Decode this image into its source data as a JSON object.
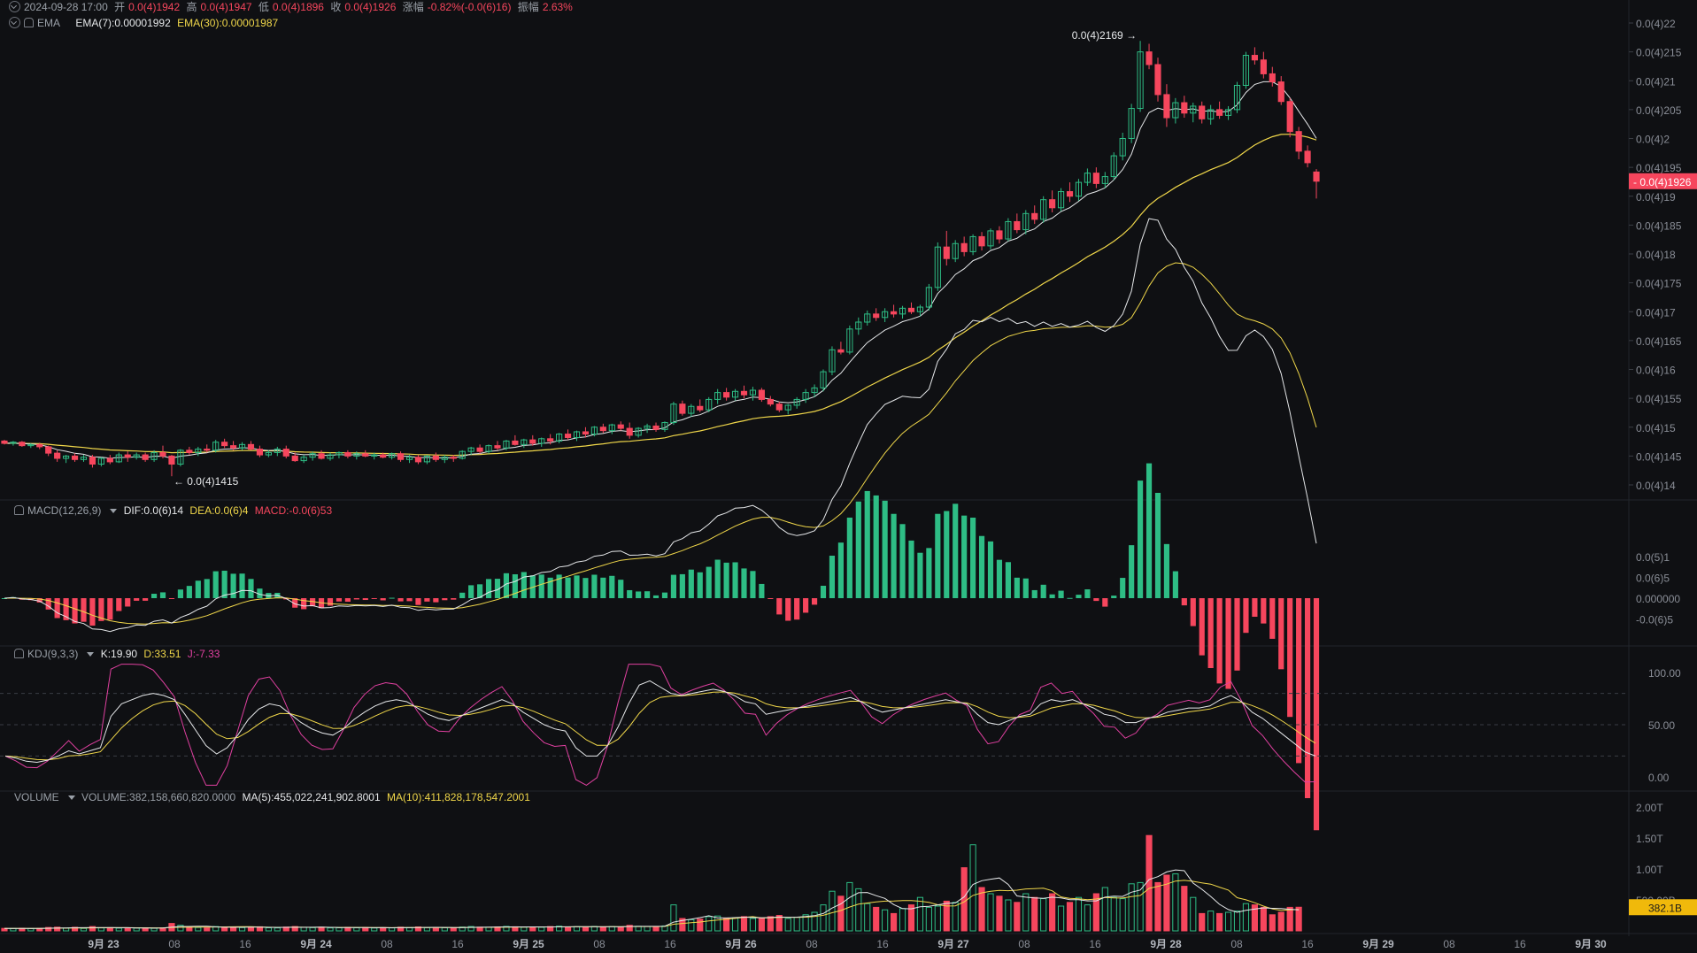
{
  "header": {
    "datetime": "2024-09-28 17:00",
    "open_label": "开",
    "open": "0.0(4)1942",
    "high_label": "高",
    "high": "0.0(4)1947",
    "low_label": "低",
    "low": "0.0(4)1896",
    "close_label": "收",
    "close": "0.0(4)1926",
    "change_label": "涨幅",
    "change": "-0.82%(-0.0(6)16)",
    "amplitude_label": "振幅",
    "amplitude": "2.63%"
  },
  "ema_legend": {
    "name": "EMA",
    "ema7": "EMA(7):0.00001992",
    "ema30": "EMA(30):0.00001987"
  },
  "macd_legend": {
    "name": "MACD(12,26,9)",
    "dif": "DIF:0.0(6)14",
    "dea": "DEA:0.0(6)4",
    "macd": "MACD:-0.0(6)53"
  },
  "kdj_legend": {
    "name": "KDJ(9,3,3)",
    "k": "K:19.90",
    "d": "D:33.51",
    "j": "J:-7.33"
  },
  "volume_legend": {
    "name": "VOLUME",
    "volume": "VOLUME:382,158,660,820.0000",
    "ma5": "MA(5):455,022,241,902.8001",
    "ma10": "MA(10):411,828,178,547.2001"
  },
  "colors": {
    "up": "#2ebd85",
    "down": "#f6465d",
    "ema7": "#e6e8ea",
    "ema30": "#f0d74a",
    "kdj_j": "#e040a0",
    "background": "#0f1013",
    "price_tag": "#f6465d",
    "volume_tag": "#f0b90b"
  },
  "chart_data": {
    "type": "candlestick",
    "price_axis_labels": [
      "0.0(4)22",
      "0.0(4)215",
      "0.0(4)21",
      "0.0(4)205",
      "0.0(4)2",
      "0.0(4)195",
      "0.0(4)19",
      "0.0(4)185",
      "0.0(4)18",
      "0.0(4)175",
      "0.0(4)17",
      "0.0(4)165",
      "0.0(4)16",
      "0.0(4)155",
      "0.0(4)15",
      "0.0(4)145",
      "0.0(4)14"
    ],
    "price_axis_values": [
      2.2e-05,
      2.15e-05,
      2.1e-05,
      2.05e-05,
      2e-05,
      1.95e-05,
      1.9e-05,
      1.85e-05,
      1.8e-05,
      1.75e-05,
      1.7e-05,
      1.65e-05,
      1.6e-05,
      1.55e-05,
      1.5e-05,
      1.45e-05,
      1.4e-05
    ],
    "current_price_label": "0.0(4)1926",
    "current_price": 1.926e-05,
    "max_marker": {
      "label": "0.0(4)2169 →",
      "value": 2.169e-05
    },
    "min_marker": {
      "label": "← 0.0(4)1415",
      "value": 1.415e-05
    },
    "time_axis_labels": [
      "9月 23",
      "08",
      "16",
      "9月 24",
      "08",
      "16",
      "9月 25",
      "08",
      "16",
      "9月 26",
      "08",
      "16",
      "9月 27",
      "08",
      "16",
      "9月 28",
      "08",
      "16",
      "9月 29",
      "08",
      "16",
      "9月 30"
    ],
    "hours_per_candle": 1,
    "candles": [
      [
        1.476,
        1.478,
        1.47,
        1.472
      ],
      [
        1.472,
        1.476,
        1.468,
        1.474
      ],
      [
        1.474,
        1.476,
        1.466,
        1.468
      ],
      [
        1.468,
        1.472,
        1.464,
        1.47
      ],
      [
        1.47,
        1.473,
        1.462,
        1.466
      ],
      [
        1.466,
        1.468,
        1.45,
        1.455
      ],
      [
        1.455,
        1.46,
        1.44,
        1.446
      ],
      [
        1.446,
        1.452,
        1.438,
        1.45
      ],
      [
        1.45,
        1.455,
        1.44,
        1.444
      ],
      [
        1.444,
        1.452,
        1.44,
        1.448
      ],
      [
        1.448,
        1.452,
        1.43,
        1.436
      ],
      [
        1.436,
        1.448,
        1.432,
        1.446
      ],
      [
        1.446,
        1.452,
        1.436,
        1.44
      ],
      [
        1.44,
        1.456,
        1.438,
        1.452
      ],
      [
        1.452,
        1.458,
        1.44,
        1.448
      ],
      [
        1.448,
        1.456,
        1.444,
        1.452
      ],
      [
        1.452,
        1.456,
        1.44,
        1.444
      ],
      [
        1.444,
        1.46,
        1.44,
        1.456
      ],
      [
        1.456,
        1.468,
        1.446,
        1.45
      ],
      [
        1.45,
        1.452,
        1.415,
        1.436
      ],
      [
        1.436,
        1.462,
        1.432,
        1.46
      ],
      [
        1.46,
        1.466,
        1.452,
        1.456
      ],
      [
        1.456,
        1.466,
        1.45,
        1.462
      ],
      [
        1.462,
        1.47,
        1.456,
        1.46
      ],
      [
        1.46,
        1.478,
        1.456,
        1.474
      ],
      [
        1.474,
        1.48,
        1.464,
        1.468
      ],
      [
        1.468,
        1.476,
        1.46,
        1.464
      ],
      [
        1.464,
        1.474,
        1.46,
        1.47
      ],
      [
        1.47,
        1.476,
        1.46,
        1.462
      ],
      [
        1.462,
        1.468,
        1.448,
        1.452
      ],
      [
        1.452,
        1.46,
        1.448,
        1.456
      ],
      [
        1.456,
        1.466,
        1.45,
        1.462
      ],
      [
        1.462,
        1.468,
        1.446,
        1.45
      ],
      [
        1.45,
        1.456,
        1.44,
        1.442
      ],
      [
        1.442,
        1.452,
        1.438,
        1.448
      ],
      [
        1.448,
        1.458,
        1.442,
        1.454
      ],
      [
        1.454,
        1.46,
        1.444,
        1.446
      ],
      [
        1.446,
        1.456,
        1.442,
        1.452
      ],
      [
        1.452,
        1.458,
        1.446,
        1.456
      ],
      [
        1.456,
        1.46,
        1.446,
        1.45
      ],
      [
        1.45,
        1.458,
        1.444,
        1.454
      ],
      [
        1.454,
        1.46,
        1.448,
        1.45
      ],
      [
        1.45,
        1.456,
        1.444,
        1.452
      ],
      [
        1.452,
        1.456,
        1.446,
        1.448
      ],
      [
        1.448,
        1.456,
        1.444,
        1.454
      ],
      [
        1.454,
        1.458,
        1.44,
        1.444
      ],
      [
        1.444,
        1.452,
        1.438,
        1.448
      ],
      [
        1.448,
        1.452,
        1.436,
        1.44
      ],
      [
        1.44,
        1.452,
        1.436,
        1.45
      ],
      [
        1.45,
        1.456,
        1.44,
        1.444
      ],
      [
        1.444,
        1.452,
        1.438,
        1.448
      ],
      [
        1.448,
        1.452,
        1.44,
        1.446
      ],
      [
        1.446,
        1.46,
        1.444,
        1.458
      ],
      [
        1.458,
        1.466,
        1.452,
        1.464
      ],
      [
        1.464,
        1.47,
        1.454,
        1.458
      ],
      [
        1.458,
        1.47,
        1.454,
        1.468
      ],
      [
        1.468,
        1.476,
        1.46,
        1.464
      ],
      [
        1.464,
        1.478,
        1.46,
        1.476
      ],
      [
        1.476,
        1.486,
        1.468,
        1.47
      ],
      [
        1.47,
        1.48,
        1.464,
        1.478
      ],
      [
        1.478,
        1.486,
        1.468,
        1.472
      ],
      [
        1.472,
        1.482,
        1.466,
        1.48
      ],
      [
        1.48,
        1.488,
        1.47,
        1.476
      ],
      [
        1.476,
        1.49,
        1.472,
        1.488
      ],
      [
        1.488,
        1.496,
        1.478,
        1.482
      ],
      [
        1.482,
        1.494,
        1.476,
        1.492
      ],
      [
        1.492,
        1.5,
        1.482,
        1.488
      ],
      [
        1.488,
        1.502,
        1.484,
        1.5
      ],
      [
        1.5,
        1.506,
        1.49,
        1.494
      ],
      [
        1.494,
        1.506,
        1.488,
        1.504
      ],
      [
        1.504,
        1.51,
        1.494,
        1.498
      ],
      [
        1.498,
        1.508,
        1.48,
        1.486
      ],
      [
        1.486,
        1.5,
        1.482,
        1.498
      ],
      [
        1.498,
        1.506,
        1.49,
        1.502
      ],
      [
        1.502,
        1.508,
        1.492,
        1.496
      ],
      [
        1.496,
        1.51,
        1.492,
        1.508
      ],
      [
        1.508,
        1.544,
        1.504,
        1.54
      ],
      [
        1.54,
        1.546,
        1.52,
        1.524
      ],
      [
        1.524,
        1.54,
        1.518,
        1.536
      ],
      [
        1.536,
        1.548,
        1.526,
        1.53
      ],
      [
        1.53,
        1.552,
        1.526,
        1.548
      ],
      [
        1.548,
        1.566,
        1.54,
        1.56
      ],
      [
        1.56,
        1.568,
        1.546,
        1.552
      ],
      [
        1.552,
        1.566,
        1.546,
        1.562
      ],
      [
        1.562,
        1.572,
        1.55,
        1.556
      ],
      [
        1.556,
        1.57,
        1.546,
        1.564
      ],
      [
        1.564,
        1.568,
        1.544,
        1.548
      ],
      [
        1.548,
        1.554,
        1.536,
        1.54
      ],
      [
        1.54,
        1.544,
        1.526,
        1.53
      ],
      [
        1.53,
        1.54,
        1.522,
        1.538
      ],
      [
        1.538,
        1.552,
        1.532,
        1.548
      ],
      [
        1.548,
        1.566,
        1.542,
        1.56
      ],
      [
        1.56,
        1.574,
        1.552,
        1.568
      ],
      [
        1.568,
        1.6,
        1.562,
        1.596
      ],
      [
        1.596,
        1.64,
        1.59,
        1.634
      ],
      [
        1.634,
        1.648,
        1.626,
        1.63
      ],
      [
        1.63,
        1.676,
        1.626,
        1.67
      ],
      [
        1.67,
        1.69,
        1.66,
        1.682
      ],
      [
        1.682,
        1.702,
        1.676,
        1.696
      ],
      [
        1.696,
        1.706,
        1.684,
        1.69
      ],
      [
        1.69,
        1.706,
        1.682,
        1.7
      ],
      [
        1.7,
        1.712,
        1.69,
        1.696
      ],
      [
        1.696,
        1.71,
        1.688,
        1.706
      ],
      [
        1.706,
        1.716,
        1.696,
        1.7
      ],
      [
        1.7,
        1.712,
        1.692,
        1.708
      ],
      [
        1.708,
        1.748,
        1.702,
        1.742
      ],
      [
        1.742,
        1.82,
        1.736,
        1.812
      ],
      [
        1.812,
        1.84,
        1.78,
        1.792
      ],
      [
        1.792,
        1.824,
        1.786,
        1.818
      ],
      [
        1.818,
        1.83,
        1.796,
        1.804
      ],
      [
        1.804,
        1.834,
        1.798,
        1.83
      ],
      [
        1.83,
        1.838,
        1.806,
        1.814
      ],
      [
        1.814,
        1.844,
        1.808,
        1.84
      ],
      [
        1.84,
        1.848,
        1.818,
        1.826
      ],
      [
        1.826,
        1.862,
        1.822,
        1.856
      ],
      [
        1.856,
        1.87,
        1.836,
        1.842
      ],
      [
        1.842,
        1.876,
        1.834,
        1.87
      ],
      [
        1.87,
        1.884,
        1.852,
        1.86
      ],
      [
        1.86,
        1.9,
        1.854,
        1.894
      ],
      [
        1.894,
        1.91,
        1.872,
        1.88
      ],
      [
        1.88,
        1.914,
        1.874,
        1.908
      ],
      [
        1.908,
        1.924,
        1.89,
        1.9
      ],
      [
        1.9,
        1.93,
        1.892,
        1.924
      ],
      [
        1.924,
        1.948,
        1.918,
        1.94
      ],
      [
        1.94,
        1.95,
        1.914,
        1.922
      ],
      [
        1.922,
        1.942,
        1.914,
        1.934
      ],
      [
        1.934,
        1.976,
        1.928,
        1.97
      ],
      [
        1.97,
        2.01,
        1.962,
        2.0
      ],
      [
        2.0,
        2.06,
        1.992,
        2.052
      ],
      [
        2.052,
        2.169,
        2.046,
        2.15
      ],
      [
        2.15,
        2.164,
        2.12,
        2.128
      ],
      [
        2.128,
        2.14,
        2.064,
        2.076
      ],
      [
        2.076,
        2.094,
        2.02,
        2.036
      ],
      [
        2.036,
        2.07,
        2.026,
        2.062
      ],
      [
        2.062,
        2.074,
        2.036,
        2.044
      ],
      [
        2.044,
        2.062,
        2.028,
        2.056
      ],
      [
        2.056,
        2.064,
        2.026,
        2.034
      ],
      [
        2.034,
        2.058,
        2.024,
        2.05
      ],
      [
        2.05,
        2.064,
        2.034,
        2.04
      ],
      [
        2.04,
        2.056,
        2.032,
        2.05
      ],
      [
        2.05,
        2.098,
        2.044,
        2.092
      ],
      [
        2.092,
        2.15,
        2.086,
        2.144
      ],
      [
        2.144,
        2.158,
        2.128,
        2.136
      ],
      [
        2.136,
        2.15,
        2.104,
        2.112
      ],
      [
        2.112,
        2.124,
        2.09,
        2.098
      ],
      [
        2.098,
        2.108,
        2.058,
        2.064
      ],
      [
        2.064,
        2.07,
        2.002,
        2.012
      ],
      [
        2.012,
        2.02,
        1.964,
        1.978
      ],
      [
        1.978,
        1.988,
        1.95,
        1.958
      ],
      [
        1.942,
        1.947,
        1.896,
        1.926
      ]
    ],
    "candle_unit": "× 0.00001",
    "ema7_label": "EMA(7)",
    "ema30_label": "EMA(30)",
    "macd_axis_labels": [
      "0.0(5)1",
      "0.0(6)5",
      "0.000000",
      "-0.0(6)5"
    ],
    "macd_axis_values": [
      1e-07,
      5e-08,
      0,
      -5e-08
    ],
    "kdj_axis_labels": [
      "100.00",
      "50.00",
      "0.00"
    ],
    "kdj_axis_values": [
      100,
      50,
      0
    ],
    "kdj_dashed_levels": [
      80,
      50,
      20
    ],
    "volume_axis_labels": [
      "2.00T",
      "1.50T",
      "1.00T",
      "500.00B"
    ],
    "volume_axis_values": [
      2000000000000.0,
      1500000000000.0,
      1000000000000.0,
      500000000000.0
    ],
    "current_volume_label": "382.1B",
    "current_volume": 382000000000.0,
    "volume_unit": "B",
    "volumes": [
      40,
      38,
      42,
      36,
      40,
      55,
      60,
      45,
      58,
      40,
      70,
      48,
      52,
      44,
      40,
      46,
      50,
      42,
      48,
      120,
      90,
      60,
      55,
      48,
      70,
      62,
      58,
      54,
      60,
      66,
      50,
      48,
      62,
      70,
      58,
      52,
      60,
      48,
      50,
      58,
      50,
      56,
      46,
      52,
      48,
      60,
      54,
      64,
      52,
      56,
      50,
      48,
      62,
      70,
      60,
      58,
      64,
      72,
      66,
      60,
      62,
      58,
      70,
      76,
      64,
      68,
      60,
      72,
      66,
      70,
      62,
      90,
      74,
      70,
      66,
      80,
      420,
      200,
      180,
      190,
      230,
      240,
      200,
      210,
      230,
      200,
      210,
      230,
      250,
      200,
      220,
      260,
      300,
      420,
      640,
      560,
      780,
      680,
      440,
      380,
      340,
      280,
      360,
      420,
      540,
      380,
      400,
      480,
      460,
      1020,
      1390,
      700,
      600,
      560,
      500,
      460,
      600,
      540,
      520,
      600,
      400,
      460,
      540,
      420,
      600,
      700,
      540,
      520,
      760,
      780,
      1540,
      780,
      900,
      920,
      720,
      540,
      280,
      320,
      280,
      300,
      320,
      440,
      420,
      380,
      260,
      300,
      380,
      382
    ],
    "kdj": {
      "k": [
        20,
        18,
        15,
        14,
        16,
        20,
        25,
        22,
        25,
        28,
        58,
        70,
        74,
        78,
        80,
        78,
        74,
        60,
        45,
        30,
        22,
        28,
        40,
        55,
        65,
        70,
        68,
        60,
        52,
        46,
        42,
        40,
        46,
        55,
        62,
        68,
        72,
        74,
        72,
        66,
        60,
        56,
        54,
        58,
        62,
        66,
        70,
        74,
        70,
        62,
        56,
        50,
        46,
        44,
        28,
        20,
        20,
        30,
        48,
        70,
        88,
        92,
        86,
        80,
        78,
        80,
        82,
        84,
        82,
        78,
        72,
        70,
        60,
        62,
        64,
        66,
        68,
        70,
        72,
        74,
        76,
        72,
        66,
        62,
        64,
        66,
        68,
        70,
        72,
        74,
        72,
        70,
        60,
        52,
        50,
        54,
        58,
        60,
        70,
        74,
        72,
        74,
        70,
        66,
        60,
        58,
        52,
        52,
        56,
        58,
        62,
        64,
        66,
        66,
        68,
        74,
        78,
        72,
        62,
        56,
        48,
        40,
        32,
        24,
        20
      ]
    }
  }
}
